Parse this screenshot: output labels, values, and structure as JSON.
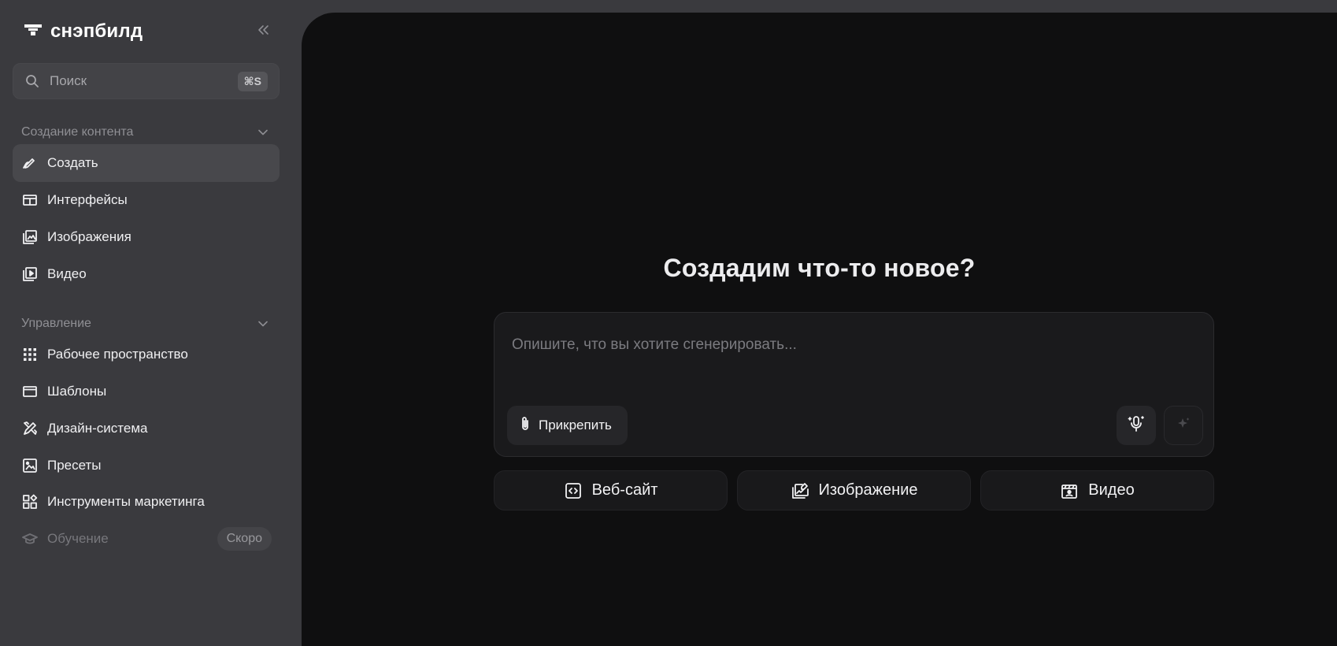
{
  "brand": {
    "name": "снэпбилд"
  },
  "search": {
    "placeholder": "Поиск",
    "shortcut": "⌘S"
  },
  "sidebar": {
    "sections": [
      {
        "title": "Создание контента",
        "items": [
          {
            "label": "Создать",
            "icon": "pen-icon",
            "active": true
          },
          {
            "label": "Интерфейсы",
            "icon": "layout-icon"
          },
          {
            "label": "Изображения",
            "icon": "images-icon"
          },
          {
            "label": "Видео",
            "icon": "video-library-icon"
          }
        ]
      },
      {
        "title": "Управление",
        "items": [
          {
            "label": "Рабочее пространство",
            "icon": "grid-dots-icon"
          },
          {
            "label": "Шаблоны",
            "icon": "browser-window-icon"
          },
          {
            "label": "Дизайн-система",
            "icon": "design-tools-icon"
          },
          {
            "label": "Пресеты",
            "icon": "image-icon"
          },
          {
            "label": "Инструменты маркетинга",
            "icon": "apps-icon"
          },
          {
            "label": "Обучение",
            "icon": "graduation-cap-icon",
            "disabled": true,
            "badge": "Скоро"
          }
        ]
      }
    ]
  },
  "main": {
    "headline": "Создадим что-то новое?",
    "prompt": {
      "placeholder": "Опишите, что вы хотите сгенерировать...",
      "attach_label": "Прикрепить"
    },
    "quick_actions": [
      {
        "label": "Веб-сайт",
        "icon": "code-icon"
      },
      {
        "label": "Изображение",
        "icon": "image-edit-icon"
      },
      {
        "label": "Видео",
        "icon": "clapperboard-icon"
      }
    ]
  },
  "colors": {
    "sidebar_bg": "#3a3a3e",
    "main_bg": "#0f0f10",
    "active_item_bg": "#48484c",
    "text_primary": "#f0f0f2",
    "text_muted": "#8f8f94"
  }
}
